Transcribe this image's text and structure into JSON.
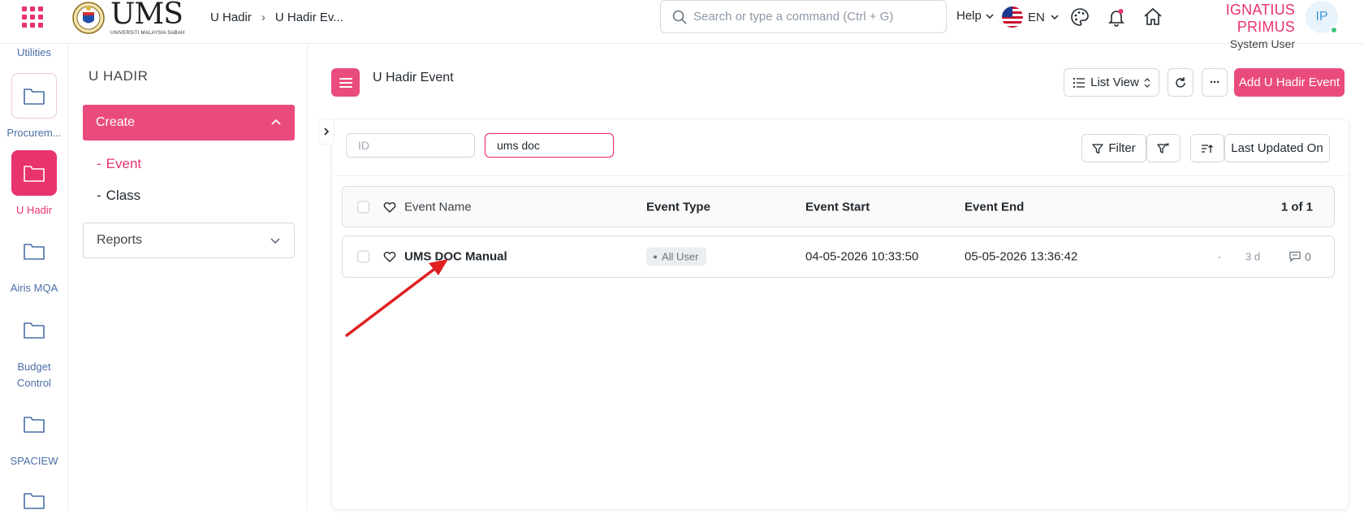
{
  "colors": {
    "accent": "#e8336d",
    "accent_button": "#ea4b7d",
    "link_blue": "#4a6fa5",
    "annotation_arrow": "#e02020"
  },
  "header": {
    "logo_text": "UMS",
    "logo_subtext": "UNIVERSITI MALAYSIA SABAH",
    "breadcrumb": [
      "U Hadir",
      "U Hadir Ev..."
    ],
    "search_placeholder": "Search or type a command (Ctrl + G)",
    "help_label": "Help",
    "language": "EN",
    "user_name": "IGNATIUS PRIMUS",
    "user_role": "System User",
    "avatar_initials": "IP",
    "icons": [
      "apps-grid-icon",
      "search-icon",
      "chevron-down-icon",
      "us-flag-icon",
      "palette-icon",
      "bell-icon",
      "home-icon"
    ]
  },
  "rail": {
    "items": [
      {
        "label": "Utilities",
        "icon": "folder-icon"
      },
      {
        "label": "Procurem...",
        "icon": "folder-icon"
      },
      {
        "label": "U Hadir",
        "icon": "folder-icon",
        "active": true
      },
      {
        "label": "Airis MQA",
        "icon": "folder-icon"
      },
      {
        "label": "Budget Control",
        "icon": "folder-icon"
      },
      {
        "label": "SPACIEW",
        "icon": "folder-icon"
      }
    ]
  },
  "sidebar": {
    "title": "U HADIR",
    "create_label": "Create",
    "links": [
      {
        "label": "Event",
        "active": true
      },
      {
        "label": "Class",
        "active": false
      }
    ],
    "reports_label": "Reports"
  },
  "main": {
    "page_title": "U Hadir Event",
    "list_view_label": "List View",
    "more_label": "···",
    "add_button_label": "Add U Hadir Event",
    "filters": {
      "id_placeholder": "ID",
      "name_value": "ums doc",
      "filter_label": "Filter",
      "sort_label": "Last Updated On"
    },
    "table": {
      "columns": [
        "Event Name",
        "Event Type",
        "Event Start",
        "Event End"
      ],
      "count_label": "1 of 1",
      "rows": [
        {
          "event_name": "UMS DOC Manual",
          "event_type": "All User",
          "event_start": "04-05-2026 10:33:50",
          "event_end": "05-05-2026 13:36:42",
          "assigned": "-",
          "modified": "3 d",
          "comments": "0"
        }
      ]
    }
  }
}
